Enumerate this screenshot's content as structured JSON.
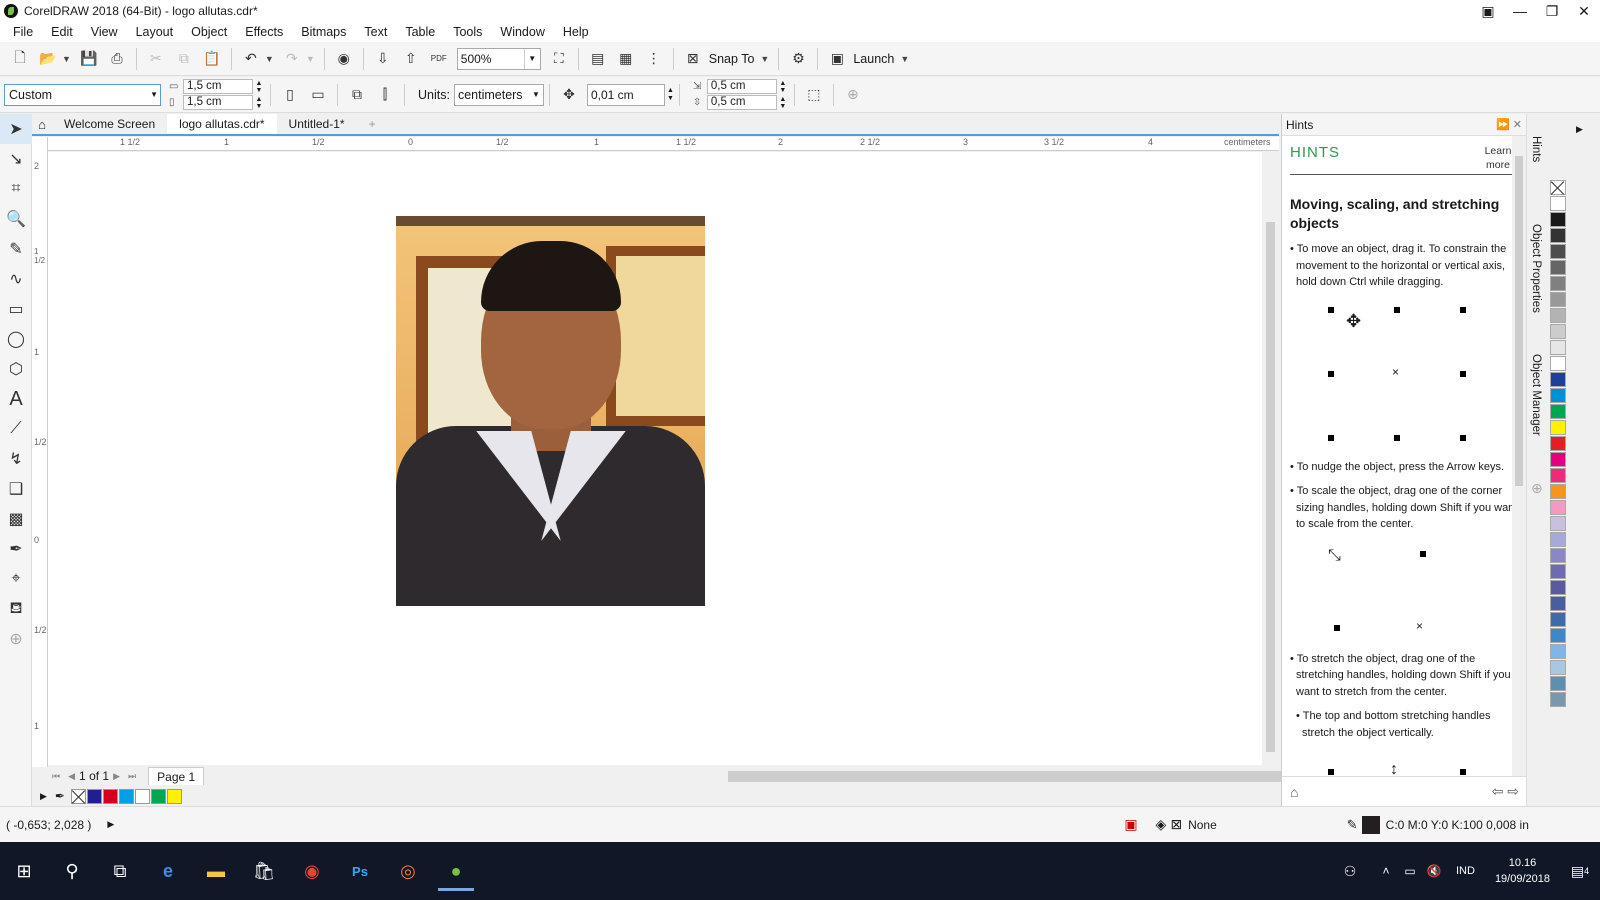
{
  "window": {
    "title": "CorelDRAW 2018 (64-Bit) - logo allutas.cdr*"
  },
  "menu": [
    "File",
    "Edit",
    "View",
    "Layout",
    "Object",
    "Effects",
    "Bitmaps",
    "Text",
    "Table",
    "Tools",
    "Window",
    "Help"
  ],
  "toolbar": {
    "zoom": "500%",
    "snap_to": "Snap To",
    "launch": "Launch",
    "pdf": "PDF"
  },
  "propbar": {
    "preset": "Custom",
    "width": "1,5 cm",
    "height": "1,5 cm",
    "units_label": "Units:",
    "units": "centimeters",
    "nudge": "0,01 cm",
    "dup_x": "0,5 cm",
    "dup_y": "0,5 cm"
  },
  "tabs": [
    "Welcome Screen",
    "logo allutas.cdr*",
    "Untitled-1*"
  ],
  "ruler": {
    "h_ticks": [
      "1 1/2",
      "1",
      "1/2",
      "0",
      "1/2",
      "1",
      "1 1/2",
      "2",
      "2 1/2",
      "3",
      "3 1/2",
      "4"
    ],
    "unit": "centimeters",
    "v_ticks": [
      "2",
      "1 1/2",
      "1",
      "1/2",
      "0",
      "1/2",
      "1"
    ]
  },
  "pagenav": {
    "current": "1",
    "of_label": "of",
    "total": "1",
    "page_tab": "Page 1"
  },
  "status": {
    "coords": "( -0,653; 2,028 )",
    "fill": "None",
    "outline": "C:0 M:0 Y:0 K:100  0,008 in"
  },
  "hints": {
    "panel_title": "Hints",
    "heading": "HINTS",
    "learn_more": "Learn more",
    "topic": "Moving, scaling, and stretching objects",
    "p1": "To move an object, drag it. To constrain the movement to the horizontal or vertical axis, hold down Ctrl while dragging.",
    "p2": "To nudge the object, press the Arrow keys.",
    "p3": "To scale the object, drag one of the corner sizing handles, holding down Shift if you want to scale from the center.",
    "p4": "To stretch the object, drag one of the stretching handles, holding down Shift if you want to stretch from the center.",
    "p5": "The top and bottom stretching handles stretch the object vertically."
  },
  "docker_tabs": [
    "Hints",
    "Object Properties",
    "Object Manager"
  ],
  "document_palette": [
    "#ffffff",
    "#1f1f8f",
    "#d6001c",
    "#00a0e3",
    "#ffffff",
    "#00a650",
    "#fff200"
  ],
  "color_palette": [
    "#ffffff",
    "#1a1a1a",
    "#333333",
    "#4d4d4d",
    "#666666",
    "#808080",
    "#999999",
    "#b3b3b3",
    "#cccccc",
    "#e6e6e6",
    "#ffffff",
    "#1f3f99",
    "#0090d8",
    "#00a650",
    "#fff200",
    "#e31e24",
    "#e6007e",
    "#ee2a7b",
    "#f7941d",
    "#f49ac1",
    "#c9c0e0",
    "#a7a9d6",
    "#8b87c5",
    "#6f6bb3",
    "#5b5aa0",
    "#4a5d9e",
    "#3f6aa8",
    "#3e88c8",
    "#7fb6e6",
    "#a7c8e0",
    "#5f8fae",
    "#7a97ad"
  ],
  "taskbar": {
    "lang": "IND",
    "time": "10.16",
    "date": "19/09/2018",
    "notif": "4"
  }
}
